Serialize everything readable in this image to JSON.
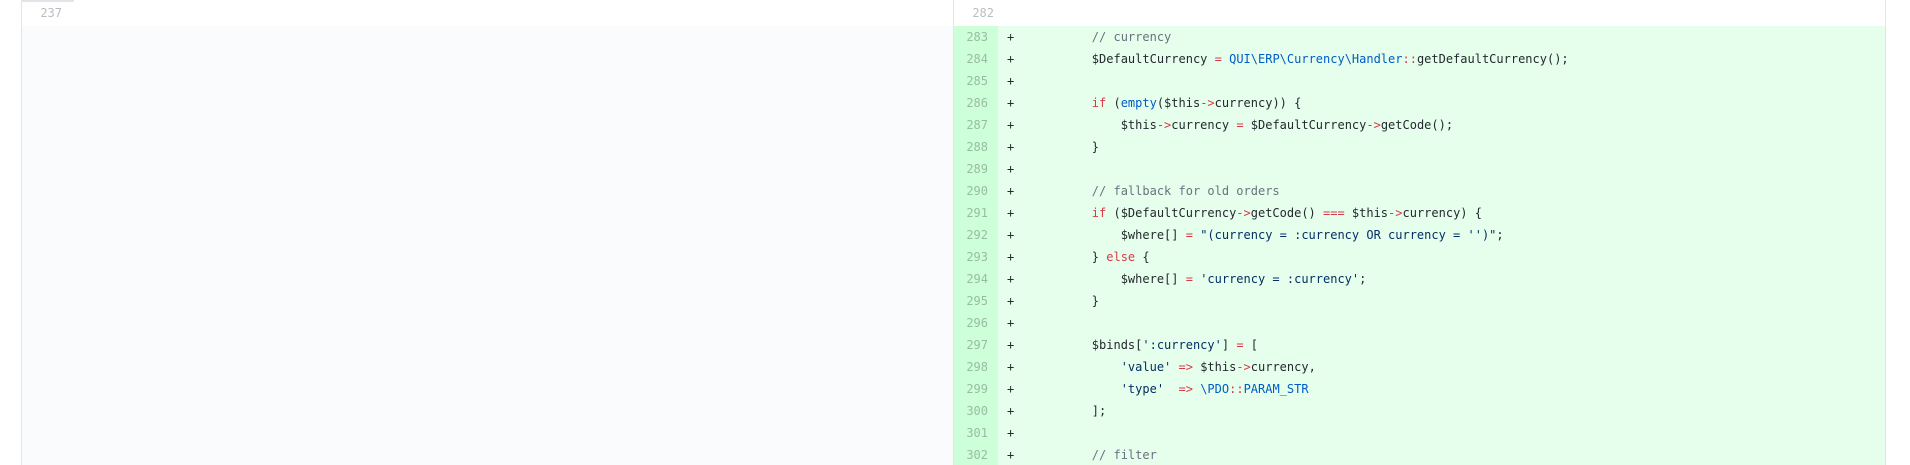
{
  "diff": {
    "left_top_line_number": "237",
    "right_top_line_number": "282",
    "marker": "+",
    "lines": [
      {
        "num": "283",
        "tokens": [
          {
            "t": "c",
            "v": "        // currency"
          }
        ]
      },
      {
        "num": "284",
        "tokens": [
          {
            "t": "",
            "v": "        $DefaultCurrency "
          },
          {
            "t": "k",
            "v": "="
          },
          {
            "t": "",
            "v": " "
          },
          {
            "t": "e",
            "v": "QUI\\ERP\\Currency\\Handler"
          },
          {
            "t": "k",
            "v": "::"
          },
          {
            "t": "",
            "v": "getDefaultCurrency();"
          }
        ]
      },
      {
        "num": "285",
        "tokens": []
      },
      {
        "num": "286",
        "tokens": [
          {
            "t": "",
            "v": "        "
          },
          {
            "t": "k",
            "v": "if"
          },
          {
            "t": "",
            "v": " ("
          },
          {
            "t": "e",
            "v": "empty"
          },
          {
            "t": "",
            "v": "($this"
          },
          {
            "t": "k",
            "v": "->"
          },
          {
            "t": "",
            "v": "currency)) {"
          }
        ]
      },
      {
        "num": "287",
        "tokens": [
          {
            "t": "",
            "v": "            $this"
          },
          {
            "t": "k",
            "v": "->"
          },
          {
            "t": "",
            "v": "currency "
          },
          {
            "t": "k",
            "v": "="
          },
          {
            "t": "",
            "v": " $DefaultCurrency"
          },
          {
            "t": "k",
            "v": "->"
          },
          {
            "t": "",
            "v": "getCode();"
          }
        ]
      },
      {
        "num": "288",
        "tokens": [
          {
            "t": "",
            "v": "        }"
          }
        ]
      },
      {
        "num": "289",
        "tokens": []
      },
      {
        "num": "290",
        "tokens": [
          {
            "t": "c",
            "v": "        // fallback for old orders"
          }
        ]
      },
      {
        "num": "291",
        "tokens": [
          {
            "t": "",
            "v": "        "
          },
          {
            "t": "k",
            "v": "if"
          },
          {
            "t": "",
            "v": " ($DefaultCurrency"
          },
          {
            "t": "k",
            "v": "->"
          },
          {
            "t": "",
            "v": "getCode() "
          },
          {
            "t": "k",
            "v": "==="
          },
          {
            "t": "",
            "v": " $this"
          },
          {
            "t": "k",
            "v": "->"
          },
          {
            "t": "",
            "v": "currency) {"
          }
        ]
      },
      {
        "num": "292",
        "tokens": [
          {
            "t": "",
            "v": "            $where[] "
          },
          {
            "t": "k",
            "v": "="
          },
          {
            "t": "",
            "v": " "
          },
          {
            "t": "s",
            "v": "\"(currency = :currency OR currency = '')\""
          },
          {
            "t": "",
            "v": ";"
          }
        ]
      },
      {
        "num": "293",
        "tokens": [
          {
            "t": "",
            "v": "        } "
          },
          {
            "t": "k",
            "v": "else"
          },
          {
            "t": "",
            "v": " {"
          }
        ]
      },
      {
        "num": "294",
        "tokens": [
          {
            "t": "",
            "v": "            $where[] "
          },
          {
            "t": "k",
            "v": "="
          },
          {
            "t": "",
            "v": " "
          },
          {
            "t": "s",
            "v": "'currency = :currency'"
          },
          {
            "t": "",
            "v": ";"
          }
        ]
      },
      {
        "num": "295",
        "tokens": [
          {
            "t": "",
            "v": "        }"
          }
        ]
      },
      {
        "num": "296",
        "tokens": []
      },
      {
        "num": "297",
        "tokens": [
          {
            "t": "",
            "v": "        $binds["
          },
          {
            "t": "s",
            "v": "':currency'"
          },
          {
            "t": "",
            "v": "] "
          },
          {
            "t": "k",
            "v": "="
          },
          {
            "t": "",
            "v": " ["
          }
        ]
      },
      {
        "num": "298",
        "tokens": [
          {
            "t": "",
            "v": "            "
          },
          {
            "t": "s",
            "v": "'value'"
          },
          {
            "t": "",
            "v": " "
          },
          {
            "t": "k",
            "v": "=>"
          },
          {
            "t": "",
            "v": " $this"
          },
          {
            "t": "k",
            "v": "->"
          },
          {
            "t": "",
            "v": "currency,"
          }
        ]
      },
      {
        "num": "299",
        "tokens": [
          {
            "t": "",
            "v": "            "
          },
          {
            "t": "s",
            "v": "'type'"
          },
          {
            "t": "",
            "v": "  "
          },
          {
            "t": "k",
            "v": "=>"
          },
          {
            "t": "",
            "v": " "
          },
          {
            "t": "e",
            "v": "\\PDO"
          },
          {
            "t": "k",
            "v": "::"
          },
          {
            "t": "e",
            "v": "PARAM_STR"
          }
        ]
      },
      {
        "num": "300",
        "tokens": [
          {
            "t": "",
            "v": "        ];"
          }
        ]
      },
      {
        "num": "301",
        "tokens": []
      },
      {
        "num": "302",
        "tokens": [
          {
            "t": "c",
            "v": "        // filter"
          }
        ]
      }
    ]
  }
}
